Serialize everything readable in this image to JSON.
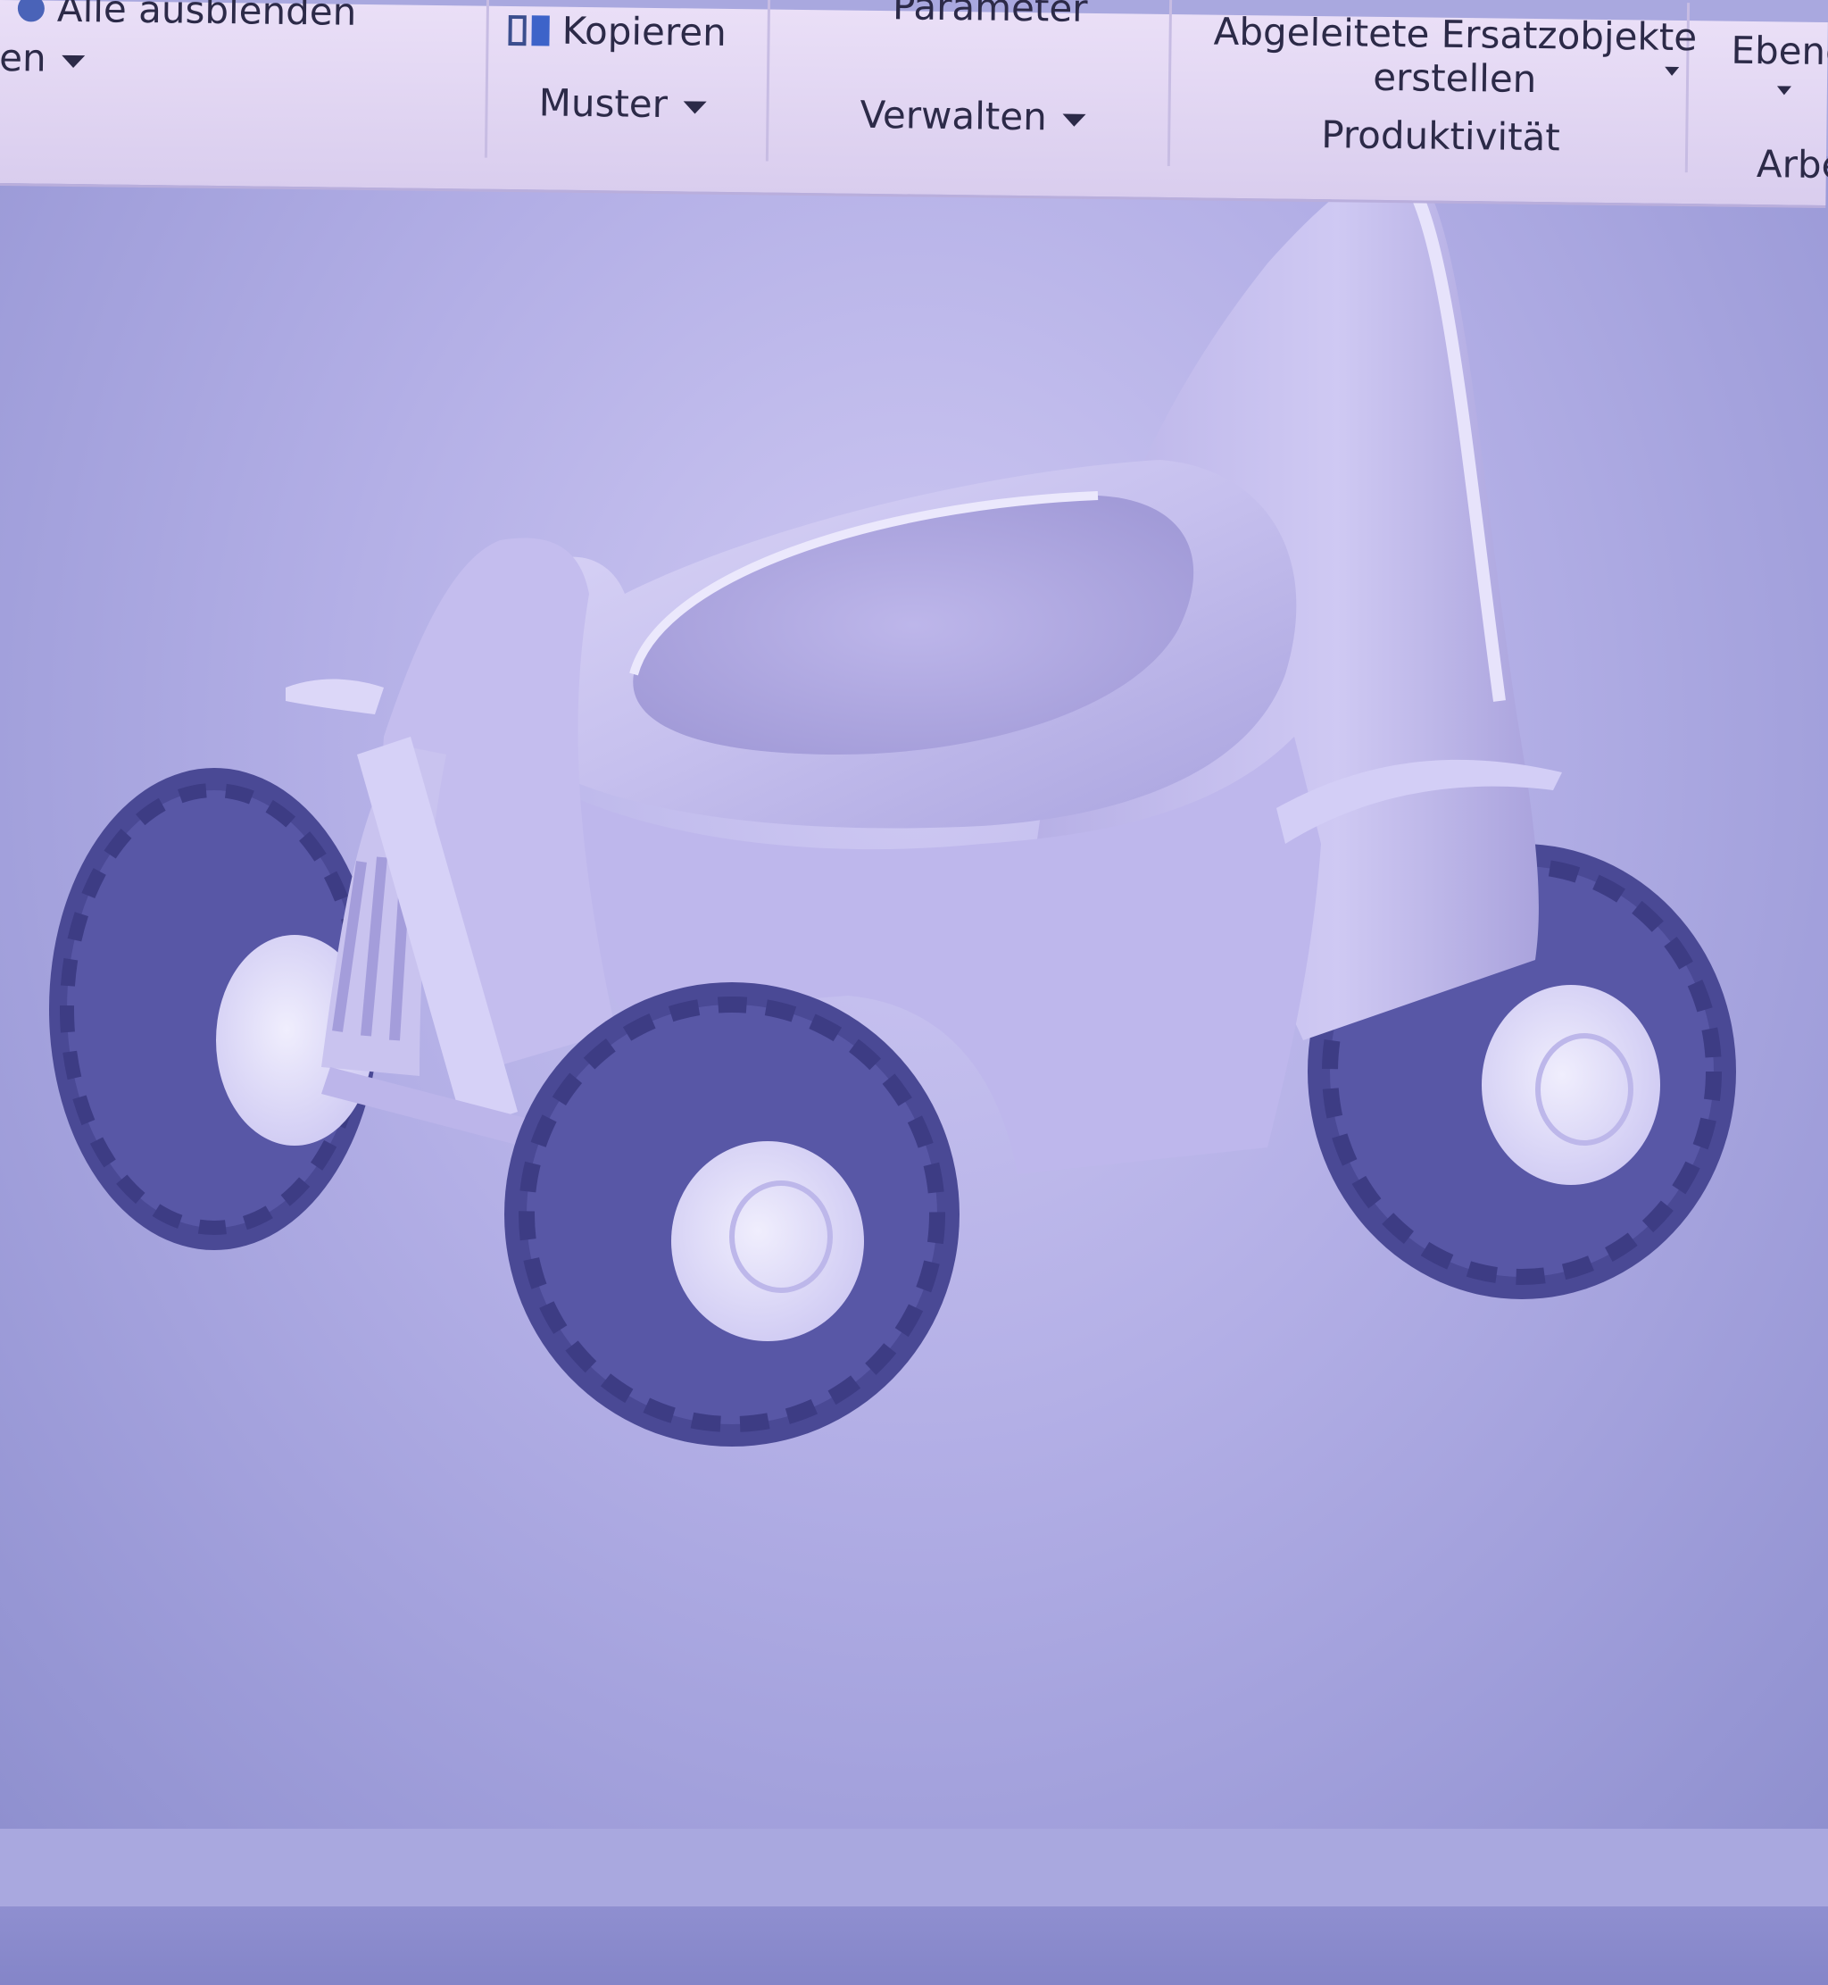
{
  "ribbon": {
    "panels": {
      "visibility": {
        "tool_label": "Alle ausblenden",
        "group_label": "en"
      },
      "pattern": {
        "tool_label": "Kopieren",
        "group_label": "Muster"
      },
      "manage": {
        "tool_label": "Parameter",
        "group_label": "Verwalten"
      },
      "productivity": {
        "tool_label_line1": "Abgeleitete Ersatzobjekte",
        "tool_label_line2": "erstellen",
        "group_label": "Produktivität"
      },
      "work": {
        "tool_label": "Ebene",
        "group_label": "Arbe"
      }
    }
  },
  "icons": {
    "visibility_tool": "lightbulb-icon",
    "copy_tool": "copy-icon",
    "dropdown": "triangle-down-icon"
  },
  "colors": {
    "ribbon_bg": "#e6dcf5",
    "viewport_bg": "#b3afe6",
    "model_body": "#c9c3ef",
    "tire": "#4c4b98",
    "rim": "#e4e0fb"
  }
}
